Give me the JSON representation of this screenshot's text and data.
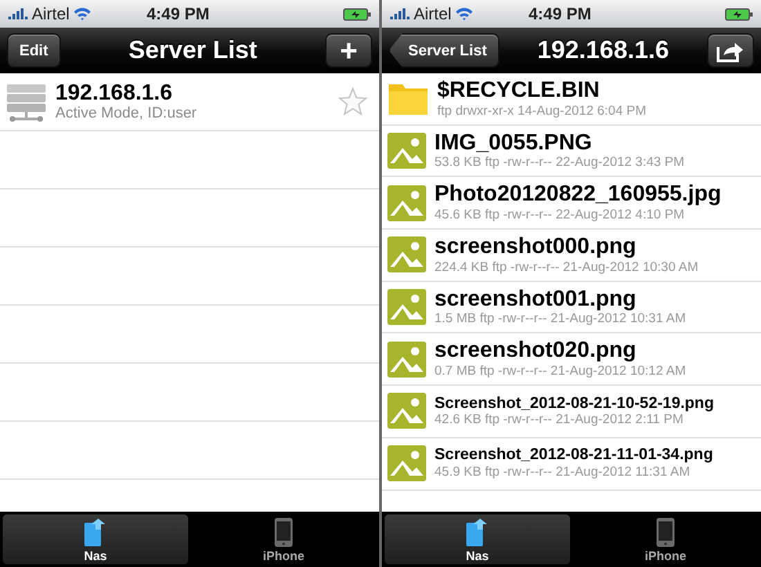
{
  "screens": [
    {
      "status_bar": {
        "carrier": "Airtel",
        "time": "4:49 PM"
      },
      "nav_bar": {
        "left_button": {
          "kind": "plain",
          "label": "Edit"
        },
        "title": "Server List",
        "right_button": {
          "kind": "text",
          "label": "+"
        }
      },
      "list": {
        "kind": "servers",
        "items": [
          {
            "kind": "server",
            "name": "192.168.1.6",
            "subtitle": "Active Mode, ID:user",
            "starred": false
          }
        ]
      },
      "tab_bar": [
        {
          "label": "Nas",
          "selected": true
        },
        {
          "label": "iPhone",
          "selected": false
        }
      ]
    },
    {
      "status_bar": {
        "carrier": "Airtel",
        "time": "4:49 PM"
      },
      "nav_bar": {
        "left_button": {
          "kind": "back",
          "label": "Server List"
        },
        "title": "192.168.1.6",
        "right_button": {
          "kind": "share"
        }
      },
      "list": {
        "kind": "files",
        "items": [
          {
            "kind": "folder",
            "name": "$RECYCLE.BIN",
            "meta": "ftp drwxr-xr-x  14-Aug-2012 6:04 PM"
          },
          {
            "kind": "image",
            "name": "IMG_0055.PNG",
            "meta": "53.8 KB ftp -rw-r--r--  22-Aug-2012 3:43 PM"
          },
          {
            "kind": "image",
            "name": "Photo20120822_160955.jpg",
            "meta": "45.6 KB ftp -rw-r--r--  22-Aug-2012 4:10 PM"
          },
          {
            "kind": "image",
            "name": "screenshot000.png",
            "meta": "224.4 KB ftp -rw-r--r--  21-Aug-2012 10:30 AM"
          },
          {
            "kind": "image",
            "name": "screenshot001.png",
            "meta": "1.5 MB ftp -rw-r--r--  21-Aug-2012 10:31 AM"
          },
          {
            "kind": "image",
            "name": "screenshot020.png",
            "meta": "0.7 MB ftp -rw-r--r--  21-Aug-2012 10:12 AM"
          },
          {
            "kind": "image",
            "name": "Screenshot_2012-08-21-10-52-19.png",
            "meta": "42.6 KB ftp -rw-r--r--  21-Aug-2012 2:11 PM"
          },
          {
            "kind": "image",
            "name": "Screenshot_2012-08-21-11-01-34.png",
            "meta": "45.9 KB ftp -rw-r--r--  21-Aug-2012 11:31 AM"
          }
        ]
      },
      "tab_bar": [
        {
          "label": "Nas",
          "selected": true
        },
        {
          "label": "iPhone",
          "selected": false
        }
      ]
    }
  ]
}
